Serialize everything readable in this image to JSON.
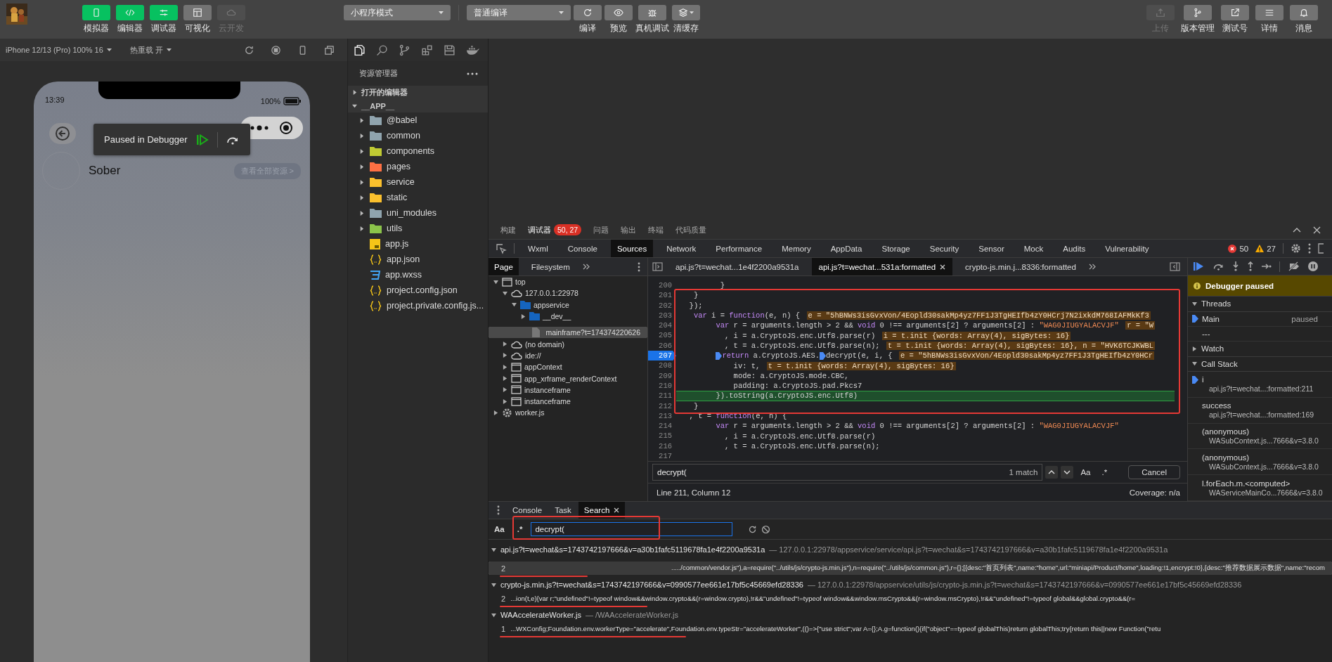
{
  "toolbar": {
    "view_buttons": [
      {
        "label": "模拟器",
        "kind": "simulator",
        "on": true,
        "disabled": false
      },
      {
        "label": "编辑器",
        "kind": "editor",
        "on": true,
        "disabled": false
      },
      {
        "label": "调试器",
        "kind": "debugger",
        "on": true,
        "disabled": false
      },
      {
        "label": "可视化",
        "kind": "visual",
        "on": false,
        "disabled": false
      },
      {
        "label": "云开发",
        "kind": "cloud",
        "on": false,
        "disabled": true
      }
    ],
    "mode_select": "小程序模式",
    "compile_select": "普通编译",
    "compile_actions": [
      {
        "label": "编译",
        "kind": "refresh"
      },
      {
        "label": "预览",
        "kind": "eye"
      },
      {
        "label": "真机调试",
        "kind": "bug"
      },
      {
        "label": "清缓存",
        "kind": "layers"
      }
    ],
    "right_actions": [
      {
        "label": "上传",
        "kind": "upload",
        "disabled": true
      },
      {
        "label": "版本管理",
        "kind": "branch",
        "disabled": false
      },
      {
        "label": "测试号",
        "kind": "external",
        "disabled": false
      },
      {
        "label": "详情",
        "kind": "menu",
        "disabled": false
      },
      {
        "label": "消息",
        "kind": "bell",
        "disabled": false
      }
    ]
  },
  "simulator": {
    "device": "iPhone 12/13 (Pro) 100% 16",
    "hot_reload": "热重载 开",
    "phone": {
      "time": "13:39",
      "battery": "100%",
      "debugger_overlay": "Paused in Debugger",
      "user_name": "Sober",
      "link": "查看全部资源 >"
    }
  },
  "explorer": {
    "title": "资源管理器",
    "sections": [
      {
        "label": "打开的编辑器",
        "expanded": false
      },
      {
        "label": "__APP__",
        "expanded": true,
        "children": [
          {
            "name": "@babel",
            "kind": "folder",
            "color": "#90a4ae",
            "expanded": false
          },
          {
            "name": "common",
            "kind": "folder",
            "color": "#90a4ae",
            "expanded": false
          },
          {
            "name": "components",
            "kind": "folder",
            "color": "#c0ca33",
            "expanded": false
          },
          {
            "name": "pages",
            "kind": "folder",
            "color": "#ff7043",
            "expanded": false
          },
          {
            "name": "service",
            "kind": "folder",
            "color": "#fbc02d",
            "expanded": false
          },
          {
            "name": "static",
            "kind": "folder",
            "color": "#fbc02d",
            "expanded": false
          },
          {
            "name": "uni_modules",
            "kind": "folder",
            "color": "#90a4ae",
            "expanded": false
          },
          {
            "name": "utils",
            "kind": "folder",
            "color": "#8bc34a",
            "expanded": false
          },
          {
            "name": "app.js",
            "kind": "js"
          },
          {
            "name": "app.json",
            "kind": "json"
          },
          {
            "name": "app.wxss",
            "kind": "css"
          },
          {
            "name": "project.config.json",
            "kind": "json"
          },
          {
            "name": "project.private.config.js...",
            "kind": "json"
          }
        ]
      }
    ]
  },
  "devtools": {
    "panel_tabs": [
      {
        "label": "构建",
        "selected": false
      },
      {
        "label": "调试器",
        "selected": true,
        "badge": "50, 27"
      },
      {
        "label": "问题",
        "selected": false
      },
      {
        "label": "输出",
        "selected": false
      },
      {
        "label": "终端",
        "selected": false
      },
      {
        "label": "代码质量",
        "selected": false
      }
    ],
    "tabs": [
      {
        "label": "Wxml",
        "selected": false
      },
      {
        "label": "Console",
        "selected": false
      },
      {
        "label": "Sources",
        "selected": true
      },
      {
        "label": "Network",
        "selected": false
      },
      {
        "label": "Performance",
        "selected": false
      },
      {
        "label": "Memory",
        "selected": false
      },
      {
        "label": "AppData",
        "selected": false
      },
      {
        "label": "Storage",
        "selected": false
      },
      {
        "label": "Security",
        "selected": false
      },
      {
        "label": "Sensor",
        "selected": false
      },
      {
        "label": "Mock",
        "selected": false
      },
      {
        "label": "Audits",
        "selected": false
      },
      {
        "label": "Vulnerability",
        "selected": false
      }
    ],
    "error_count": "50",
    "warning_count": "27",
    "navigator": {
      "tabs": [
        {
          "label": "Page",
          "selected": true
        },
        {
          "label": "Filesystem",
          "selected": false
        }
      ],
      "tree": [
        {
          "name": "top",
          "kind": "frame",
          "expanded": true,
          "selected": false,
          "children": [
            {
              "name": "127.0.0.1:22978",
              "kind": "cloud",
              "expanded": true,
              "selected": false,
              "children": [
                {
                  "name": "appservice",
                  "kind": "folder",
                  "expanded": true,
                  "selected": false,
                  "children": [
                    {
                      "name": "__dev__",
                      "kind": "folder",
                      "expanded": false,
                      "selected": false
                    },
                    {
                      "name": "mainframe?t=174374220626",
                      "kind": "file",
                      "selected": true
                    }
                  ]
                }
              ]
            },
            {
              "name": "(no domain)",
              "kind": "cloud",
              "expanded": false,
              "selected": false
            },
            {
              "name": "ide://",
              "kind": "cloud",
              "expanded": false,
              "selected": false
            },
            {
              "name": "appContext",
              "kind": "frame",
              "expanded": false,
              "selected": false
            },
            {
              "name": "app_xrframe_renderContext",
              "kind": "frame",
              "expanded": false,
              "selected": false
            },
            {
              "name": "instanceframe",
              "kind": "frame",
              "expanded": false,
              "selected": false
            },
            {
              "name": "instanceframe",
              "kind": "frame",
              "expanded": false,
              "selected": false
            }
          ]
        },
        {
          "name": "worker.js",
          "kind": "gear",
          "expanded": false,
          "selected": false
        }
      ]
    },
    "editor": {
      "tabs": [
        {
          "label": "api.js?t=wechat...1e4f2200a9531a",
          "selected": false
        },
        {
          "label": "api.js?t=wechat...531a:formatted",
          "selected": true
        },
        {
          "label": "crypto-js.min.j...8336:formatted",
          "selected": false
        }
      ],
      "annotation_box": true,
      "lines": [
        {
          "number": "200",
          "kind": "normal",
          "code": "         }"
        },
        {
          "number": "201",
          "kind": "normal",
          "code": "   }"
        },
        {
          "number": "202",
          "kind": "normal",
          "code": "  });"
        },
        {
          "number": "203",
          "kind": "normal",
          "code": "   var i = function(e, n) {",
          "value": "e = \"5hBNWs3isGvxVon/4Eopld30sakMp4yz7FF1J3TgHEIfb4zY0HCrj7N2ixkdM768IAFMkKf3"
        },
        {
          "number": "204",
          "kind": "normal",
          "code": "        var r = arguments.length > 2 && void 0 !== arguments[2] ? arguments[2] : \"WAG0JIUGYALACVJF\"",
          "value": "r = \"W"
        },
        {
          "number": "205",
          "kind": "normal",
          "code": "          , i = a.CryptoJS.enc.Utf8.parse(r)",
          "value": "i = t.init {words: Array(4), sigBytes: 16}"
        },
        {
          "number": "206",
          "kind": "normal",
          "code": "          , t = a.CryptoJS.enc.Utf8.parse(n);",
          "value": "t = t.init {words: Array(4), sigBytes: 16}, n = \"HVK6TCJKWBL"
        },
        {
          "number": "207",
          "kind": "paused",
          "parts": [
            "        return a.CryptoJS.AES.",
            "decrypt(e, i, {"
          ],
          "value": "e = \"5hBNWs3isGvxVon/4Eopld30sakMp4yz7FF1J3TgHEIfb4zY0HCr"
        },
        {
          "number": "208",
          "kind": "normal",
          "code": "            iv: t,",
          "value": "t = t.init {words: Array(4), sigBytes: 16}"
        },
        {
          "number": "209",
          "kind": "normal",
          "code": "            mode: a.CryptoJS.mode.CBC,"
        },
        {
          "number": "210",
          "kind": "normal",
          "code": "            padding: a.CryptoJS.pad.Pkcs7"
        },
        {
          "number": "211",
          "kind": "current",
          "code": "        }).toString(a.CryptoJS.enc.Utf8)"
        },
        {
          "number": "212",
          "kind": "normal",
          "code": "   }"
        },
        {
          "number": "213",
          "kind": "normal",
          "code": "  , t = function(e, n) {"
        },
        {
          "number": "214",
          "kind": "normal",
          "code": "        var r = arguments.length > 2 && void 0 !== arguments[2] ? arguments[2] : \"WAG0JIUGYALACVJF\""
        },
        {
          "number": "215",
          "kind": "normal",
          "code": "          , i = a.CryptoJS.enc.Utf8.parse(r)"
        },
        {
          "number": "216",
          "kind": "normal",
          "code": "          , t = a.CryptoJS.enc.Utf8.parse(n);"
        },
        {
          "number": "217",
          "kind": "normal"
        }
      ],
      "find": {
        "value": "decrypt(",
        "matches": "1 match",
        "case_toggle": "Aa",
        "regex_toggle": ".*",
        "cancel": "Cancel"
      },
      "status": "Line 211, Column 12",
      "coverage": "Coverage: n/a"
    },
    "debugger": {
      "banner": "Debugger paused",
      "threads": {
        "label": "Threads",
        "expanded": true,
        "items": [
          {
            "name": "Main",
            "status": "paused",
            "selected": true
          }
        ],
        "more": "---"
      },
      "watch": {
        "label": "Watch",
        "expanded": false
      },
      "call_stack": {
        "label": "Call Stack",
        "expanded": true,
        "frames": [
          {
            "function": "i",
            "location": "api.js?t=wechat...:formatted:211",
            "selected": true
          },
          {
            "function": "success",
            "location": "api.js?t=wechat...:formatted:169",
            "selected": false
          },
          {
            "function": "(anonymous)",
            "location": "WASubContext.js...7666&v=3.8.0",
            "selected": false
          },
          {
            "function": "(anonymous)",
            "location": "WASubContext.js...7666&v=3.8.0",
            "selected": false
          },
          {
            "function": "l.forEach.m.<computed>",
            "location": "WAServiceMainCo...7666&v=3.8.0",
            "selected": false
          }
        ]
      }
    },
    "drawer": {
      "tabs": [
        {
          "label": "Console",
          "selected": false
        },
        {
          "label": "Task",
          "selected": false
        },
        {
          "label": "Search",
          "selected": true
        }
      ],
      "search": {
        "case_toggle": "Aa",
        "regex_toggle": ".*",
        "value": "decrypt(",
        "annotation_box": true
      },
      "results": [
        {
          "file": "api.js?t=wechat&s=1743742197666&v=a30b1fafc5119678fa1e4f2200a9531a",
          "path": "— 127.0.0.1:22978/appservice/service/api.js?t=wechat&s=1743742197666&v=a30b1fafc5119678fa1e4f2200a9531a",
          "line": "2",
          "text": "...../common/vendor.js\"),a=require(\"../utils/js/crypto-js.min.js\"),n=require(\"../utils/js/common.js\"),r={};[{desc:\"首页列表\",name:\"home\",url:\"miniapi/Product/home\",loading:!1,encrypt:!0},{desc:\"推荐数据展示数据\",name:\"recom",
          "selected": true,
          "underlined": true
        },
        {
          "file": "crypto-js.min.js?t=wechat&s=1743742197666&v=0990577ee661e17bf5c45669efd28336",
          "path": "— 127.0.0.1:22978/appservice/utils/js/crypto-js.min.js?t=wechat&s=1743742197666&v=0990577ee661e17bf5c45669efd28336",
          "line": "2",
          "text": "...ion(t,e){var r;\"undefined\"!=typeof window&&window.crypto&&(r=window.crypto),!r&&\"undefined\"!=typeof window&&window.msCrypto&&(r=window.msCrypto),!r&&\"undefined\"!=typeof global&&global.crypto&&(r=",
          "selected": false,
          "underlined": true
        },
        {
          "file": "WAAccelerateWorker.js",
          "path": "— /WAAccelerateWorker.js",
          "line": "1",
          "text": "...WXConfig;Foundation.env.workerType=\"accelerate\",Foundation.env.typeStr=\"accelerateWorker\",(()=>{\"use strict\";var A={};A.g=function(){if(\"object\"==typeof globalThis)return globalThis;try{return this||new Function(\"retu",
          "selected": false,
          "underlined": true
        }
      ]
    }
  }
}
